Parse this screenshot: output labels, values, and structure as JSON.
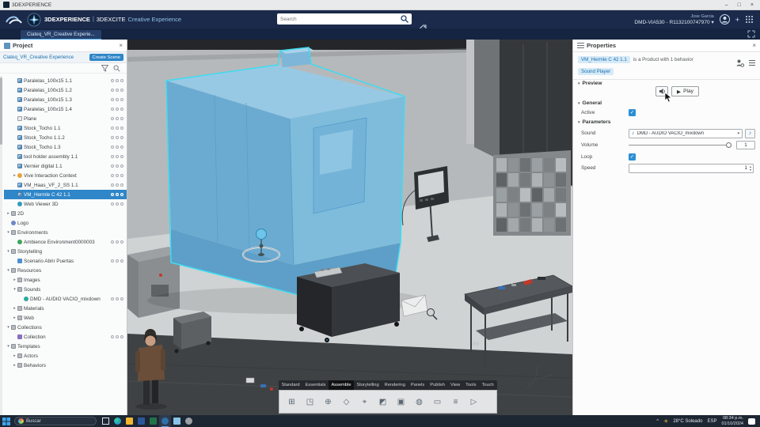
{
  "window": {
    "title": "3DEXPERIENCE"
  },
  "appbar": {
    "brand": "3DEXPERIENCE",
    "separator": "|",
    "app_name": "3DEXCITE",
    "app_suffix": "Creative Experience",
    "search_placeholder": "Search",
    "user_name": "Jose Garcia",
    "tenant": "DMD-VIA530 - R1132100747970"
  },
  "tabbar": {
    "document_tab": "Ciateq_VR_Creative Experie..."
  },
  "project": {
    "title": "Project",
    "root_label": "Ciateq_VR_Creative Experience",
    "create_scene": "Create Scene",
    "tree": [
      {
        "label": "Paralelas_100x15 1.1",
        "indent": 1,
        "icon": "part",
        "trail": true
      },
      {
        "label": "Paralelas_100x15 1.2",
        "indent": 1,
        "icon": "part",
        "trail": true
      },
      {
        "label": "Paralelas_100x15 1.3",
        "indent": 1,
        "icon": "part",
        "trail": true
      },
      {
        "label": "Paralelas_100x15 1.4",
        "indent": 1,
        "icon": "part",
        "trail": true
      },
      {
        "label": "Plane",
        "indent": 1,
        "icon": "plane",
        "trail": true
      },
      {
        "label": "Stock_Tocho 1.1",
        "indent": 1,
        "icon": "part",
        "trail": true
      },
      {
        "label": "Stock_Tocho 1.1.2",
        "indent": 1,
        "icon": "part",
        "trail": true
      },
      {
        "label": "Stock_Tocho 1.3",
        "indent": 1,
        "icon": "part",
        "trail": true
      },
      {
        "label": "tool holder assembly 1.1",
        "indent": 1,
        "icon": "part",
        "trail": true
      },
      {
        "label": "Vernier digital 1.1",
        "indent": 1,
        "icon": "part",
        "trail": true
      },
      {
        "label": "Vive Interaction Context",
        "indent": 1,
        "icon": "context",
        "arrow": "right",
        "trail": true
      },
      {
        "label": "VM_Haas_VF_2_SS 1.1",
        "indent": 1,
        "icon": "part",
        "trail": true
      },
      {
        "label": "VM_Hermle C 42 1.1",
        "indent": 1,
        "icon": "part",
        "trail": true,
        "selected": true
      },
      {
        "label": "Web Viewer 3D",
        "indent": 1,
        "icon": "web",
        "trail": true
      },
      {
        "label": "2D",
        "indent": 0,
        "icon": "folder",
        "arrow": "right"
      },
      {
        "label": "Logo",
        "indent": 0,
        "icon": "logo"
      },
      {
        "label": "Environments",
        "indent": 0,
        "icon": "folder",
        "arrow": "down"
      },
      {
        "label": "Ambience Environment0000003",
        "indent": 1,
        "icon": "env",
        "trail": true
      },
      {
        "label": "Storytelling",
        "indent": 0,
        "icon": "folder",
        "arrow": "down"
      },
      {
        "label": "Scenario Abrir Puertas",
        "indent": 1,
        "icon": "scen",
        "trail": true
      },
      {
        "label": "Resources",
        "indent": 0,
        "icon": "folder",
        "arrow": "down"
      },
      {
        "label": "Images",
        "indent": 1,
        "icon": "folder",
        "arrow": "right"
      },
      {
        "label": "Sounds",
        "indent": 1,
        "icon": "folder",
        "arrow": "down"
      },
      {
        "label": "DMD - AUDIO VACIO_mixdown",
        "indent": 2,
        "icon": "sound",
        "trail": true
      },
      {
        "label": "Materials",
        "indent": 1,
        "icon": "folder",
        "arrow": "right"
      },
      {
        "label": "Web",
        "indent": 1,
        "icon": "folder",
        "arrow": "right"
      },
      {
        "label": "Collections",
        "indent": 0,
        "icon": "folder",
        "arrow": "down"
      },
      {
        "label": "Collection",
        "indent": 1,
        "icon": "coll",
        "trail": true
      },
      {
        "label": "Templates",
        "indent": 0,
        "icon": "folder",
        "arrow": "down"
      },
      {
        "label": "Actors",
        "indent": 1,
        "icon": "folder",
        "arrow": "right"
      },
      {
        "label": "Behaviors",
        "indent": 1,
        "icon": "folder",
        "arrow": "right"
      }
    ]
  },
  "properties": {
    "title": "Properties",
    "object_name": "VM_Hermle C 42 1.1",
    "object_desc": "is a Product with 1 behavior",
    "behavior_chip": "Sound Player",
    "preview_label": "Preview",
    "play_label": "Play",
    "general_label": "General",
    "active_label": "Active",
    "parameters_label": "Parameters",
    "sound_label": "Sound",
    "sound_value": "DMD - AUDIO VACIO_mixdown",
    "volume_label": "Volume",
    "volume_value": "1",
    "loop_label": "Loop",
    "speed_label": "Speed",
    "speed_value": "1"
  },
  "ribbon": {
    "tabs": [
      "Standard",
      "Essentials",
      "Assemble",
      "Storytelling",
      "Rendering",
      "Panels",
      "Publish",
      "View",
      "Tools",
      "Touch"
    ],
    "active_tab": "Assemble",
    "icons": [
      {
        "name": "import-icon",
        "glyph": "⊞"
      },
      {
        "name": "product-structure-icon",
        "glyph": "◳"
      },
      {
        "name": "snap-icon",
        "glyph": "⊕"
      },
      {
        "name": "magnet-icon",
        "glyph": "◇"
      },
      {
        "name": "measure-icon",
        "glyph": "⌖"
      },
      {
        "name": "section-icon",
        "glyph": "◩"
      },
      {
        "name": "camera-icon",
        "glyph": "▣"
      },
      {
        "name": "render-icon",
        "glyph": "◍"
      },
      {
        "name": "screen-icon",
        "glyph": "▭"
      },
      {
        "name": "list-icon",
        "glyph": "≡"
      },
      {
        "name": "play-icon",
        "glyph": "▷"
      }
    ]
  },
  "taskbar": {
    "search_placeholder": "Buscar",
    "icons": [
      "task-view",
      "edge",
      "file-explorer",
      "word",
      "excel",
      "3dexperience",
      "notepad",
      "settings"
    ],
    "active_icon": "3dexperience",
    "weather_temp": "28°C",
    "weather_desc": "Soleado",
    "lang": "ESP",
    "time": "08:34 p.m.",
    "date": "01/10/2024"
  }
}
